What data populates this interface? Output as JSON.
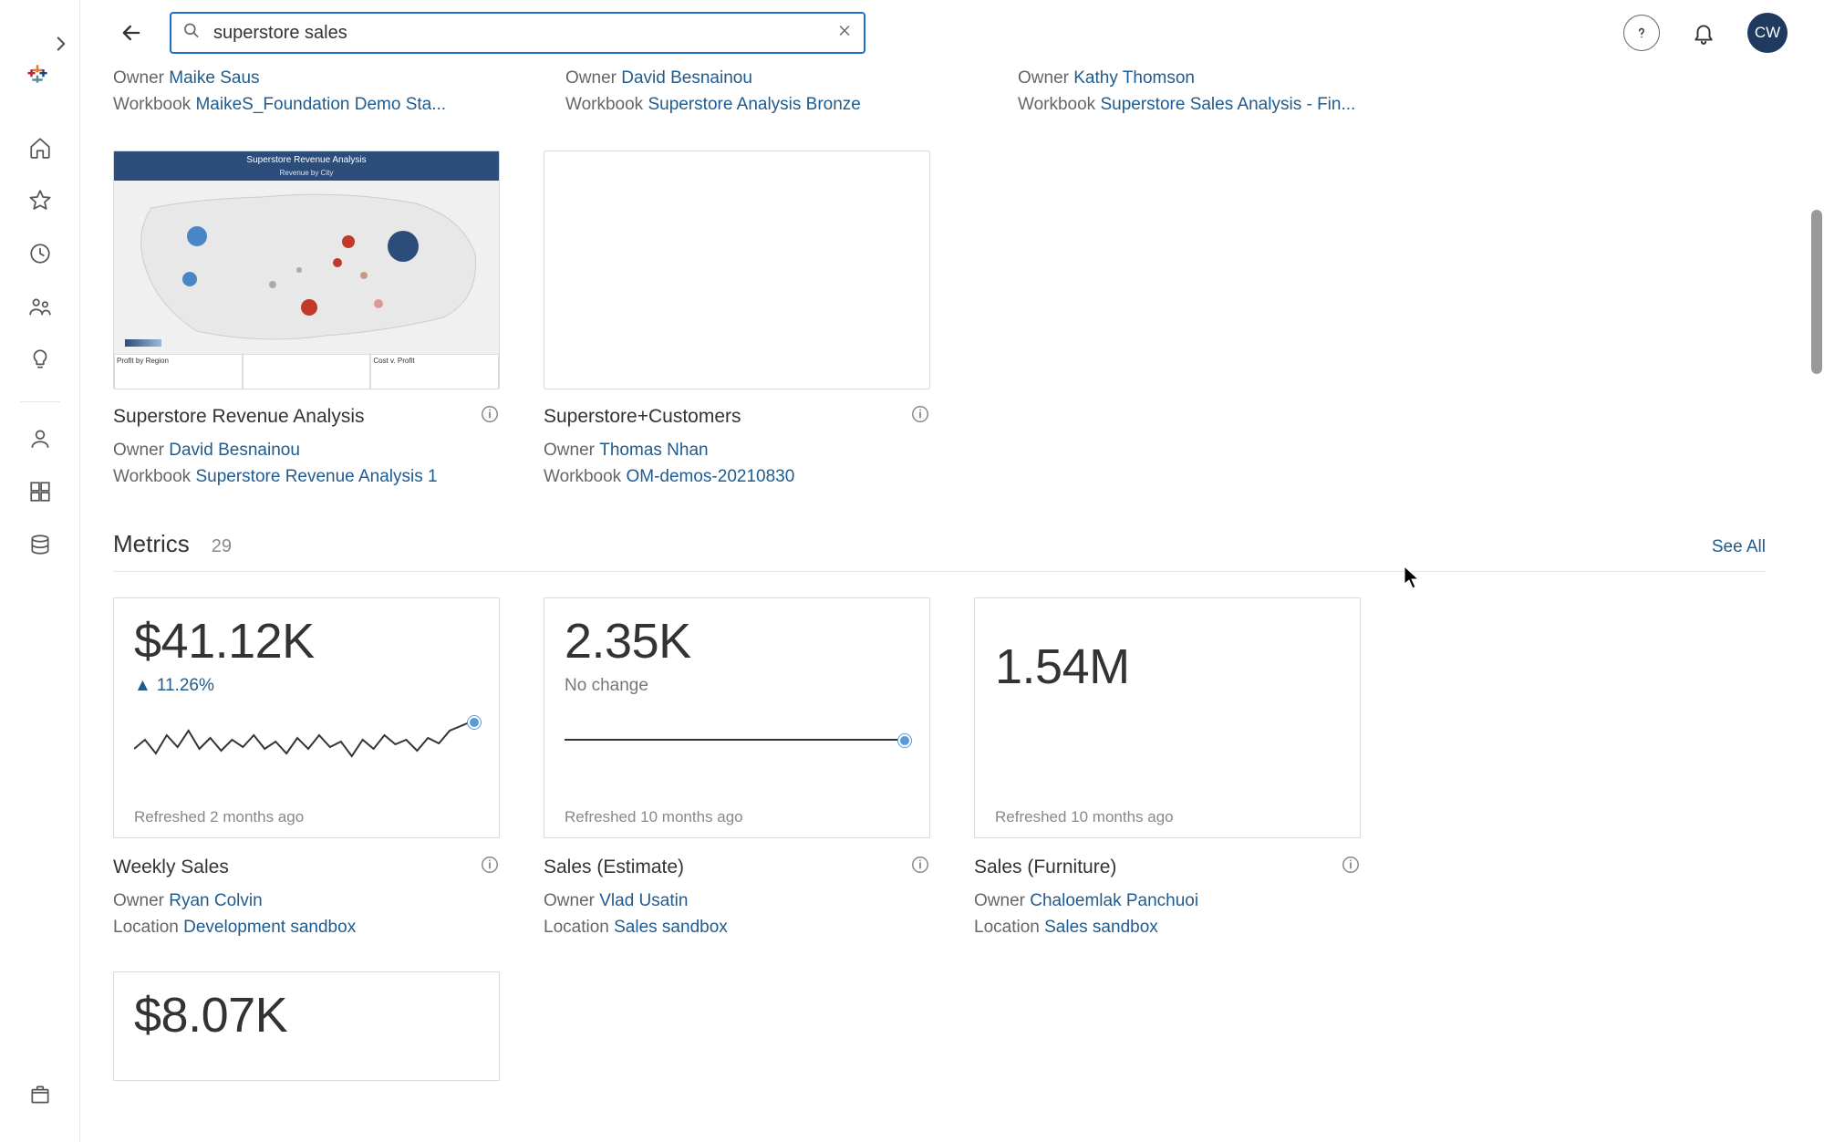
{
  "search": {
    "value": "superstore sales"
  },
  "user": {
    "initials": "CW"
  },
  "top_results": [
    {
      "owner_label": "Owner",
      "owner": "Maike Saus",
      "wb_label": "Workbook",
      "workbook": "MaikeS_Foundation Demo Sta..."
    },
    {
      "owner_label": "Owner",
      "owner": "David Besnainou",
      "wb_label": "Workbook",
      "workbook": "Superstore Analysis Bronze"
    },
    {
      "owner_label": "Owner",
      "owner": "Kathy Thomson",
      "wb_label": "Workbook",
      "workbook": "Superstore Sales Analysis - Fin..."
    }
  ],
  "views": [
    {
      "title": "Superstore Revenue Analysis",
      "owner_label": "Owner",
      "owner": "David Besnainou",
      "wb_label": "Workbook",
      "workbook": "Superstore Revenue Analysis 1",
      "thumb_title": "Superstore Revenue Analysis",
      "thumb_sub": "Revenue by City"
    },
    {
      "title": "Superstore+Customers",
      "owner_label": "Owner",
      "owner": "Thomas Nhan",
      "wb_label": "Workbook",
      "workbook": "OM-demos-20210830"
    }
  ],
  "metrics_section": {
    "title": "Metrics",
    "count": "29",
    "see_all": "See All"
  },
  "metrics": [
    {
      "value": "$41.12K",
      "change": "11.26%",
      "change_dir": "up",
      "refresh": "Refreshed 2 months ago",
      "title": "Weekly Sales",
      "owner_label": "Owner",
      "owner": "Ryan Colvin",
      "loc_label": "Location",
      "location": "Development sandbox"
    },
    {
      "value": "2.35K",
      "change": "No change",
      "change_dir": "none",
      "refresh": "Refreshed 10 months ago",
      "title": "Sales (Estimate)",
      "owner_label": "Owner",
      "owner": "Vlad Usatin",
      "loc_label": "Location",
      "location": "Sales sandbox"
    },
    {
      "value": "1.54M",
      "change": "",
      "change_dir": "",
      "refresh": "Refreshed 10 months ago",
      "title": "Sales (Furniture)",
      "owner_label": "Owner",
      "owner": "Chaloemlak Panchuoi",
      "loc_label": "Location",
      "location": "Sales sandbox"
    },
    {
      "value": "$8.07K"
    }
  ]
}
